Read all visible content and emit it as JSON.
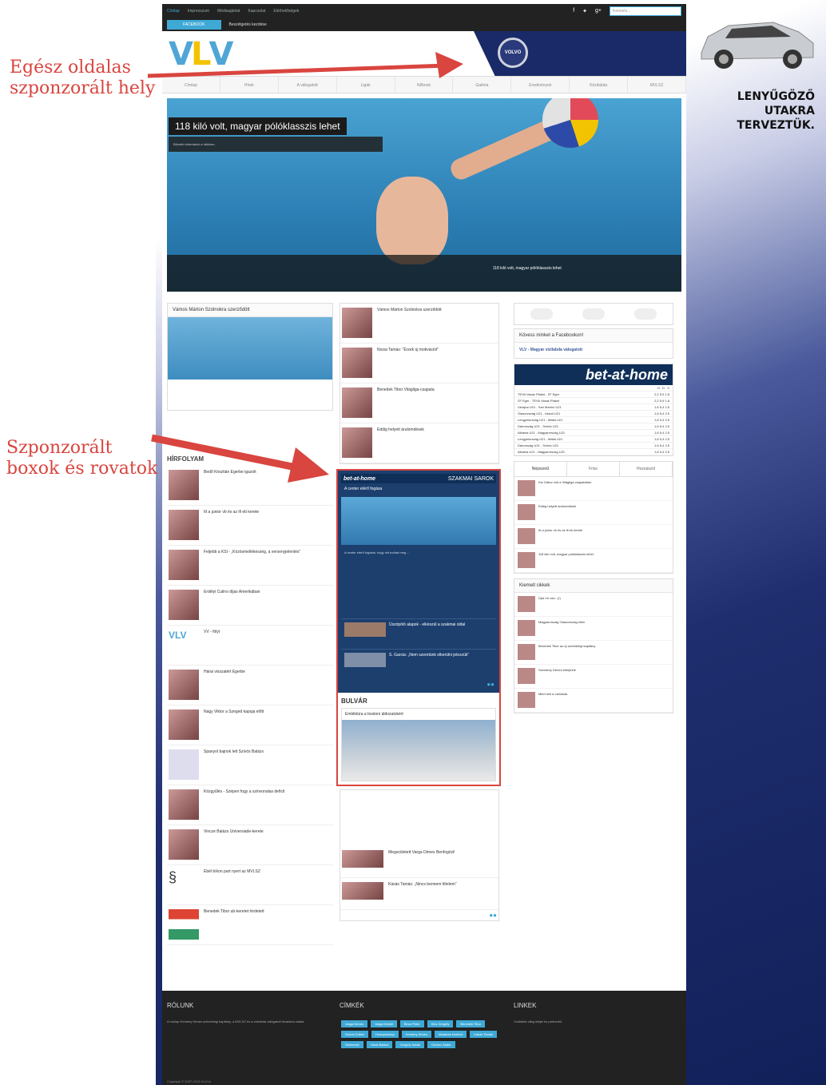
{
  "annotations": {
    "fullpage": [
      "Egész oldalas",
      "szponzorált hely"
    ],
    "boxes": [
      "Szponzorált",
      "boxok és rovatok"
    ]
  },
  "topbar": {
    "nav": [
      "Címlap",
      "Impresszum",
      "Médiaajánlat",
      "Kapcsolat",
      "Elérhetőségek"
    ],
    "search_placeholder": "Keresés..."
  },
  "subbar": {
    "facebook": "FACEBOOK",
    "ticker": "Beszélgetés kezdése"
  },
  "logo": {
    "v1": "V",
    "l": "L",
    "v2": "V"
  },
  "brand": {
    "badge": "VOLVO"
  },
  "menu": [
    "Címlap",
    "Hírek",
    "A válogatott",
    "Ligák",
    "Nőknek",
    "Galéria",
    "Eredmények",
    "Kézilabda",
    "MVLSZ"
  ],
  "hero": {
    "title": "118 kiló volt, magyar pólóklasszis lehet",
    "lead": "Bővebb információ a cikkben...",
    "strip": [
      "",
      "",
      "",
      "118 kiló volt, magyar pólóklasszis lehet",
      ""
    ]
  },
  "col1": {
    "feature_title": "Vámos Márton Szolnokra szerződött",
    "news_header": "HÍRFOLYAM",
    "items": [
      "Bedő Krisztián Egerbe igazolt",
      "Itt a junior vb és az ifi eb kerete",
      "Feljebb a KSI - „Közösmellékesség, a versenyjelentés”",
      "Erdélyi Culino díjas Amerikában",
      "VV - fölyt",
      "Hárai visszatért Egerbe",
      "Nagy Viktor a Szeged kapuja előtt",
      "Spanyol bajnok lett Szívós Balázs",
      "Közgyűlés - Szépen fogy a szinvonalas deficit",
      "Vincze Balázs Universiade-kerete",
      "Ebél bíkon part nyert az MVLSZ",
      "Benedek Tibor ub-keretet hirdetett"
    ]
  },
  "col2": {
    "items": [
      "Vámos Márton Szolnokra szerződött",
      "Nozai Tamás: \"Érzek új motivációt\"",
      "Benedek Tibor Világliga-csapata",
      "Eddig helyett árulomdések"
    ],
    "sponsor": {
      "brand": "bet-at-home",
      "section": "SZAKMAI SAROK",
      "headline": "A center elérő fogása",
      "body": "A center elérő fogásai, hogy mit tudhat meg....",
      "list": [
        "Úszópóló alapok - elkészül a szakmai oldal",
        "S. Garcia: „Nem szeretünk elkerülni jelezzük”"
      ]
    },
    "bulvar": {
      "header": "BULVÁR",
      "title": "Emléktúra a bostoni áldozatokért"
    },
    "after": [
      "Megszületett Varga Dénes Benfogózi!",
      "Kásás Tamás: „Nincs bennem félelem”"
    ]
  },
  "col3": {
    "facebook": "Kövess minket a Facebookon!",
    "fb_page": "VLV - Magyar vízilabda válogatott",
    "betathome": "bet-at-home",
    "odds_header": [
      "H",
      "D",
      "V"
    ],
    "matches": [
      [
        "TEVA Vasas Plaket - ZF Eger",
        "2,2",
        "5,9",
        "1,8"
      ],
      [
        "ZF Eger - TEVA Vasas Plaket",
        "2,2",
        "5,9",
        "1,8"
      ],
      [
        "Ukrajna U21 - San Marino U21",
        "1,6",
        "5,4",
        "2,5"
      ],
      [
        "Olaszország U21 - Izland U21",
        "1,6",
        "5,4",
        "2,5"
      ],
      [
        "Lengyelország U21 - Málta U21",
        "1,6",
        "5,4",
        "2,5"
      ],
      [
        "Dánország U21 - Svédo U21",
        "1,6",
        "5,4",
        "2,5"
      ],
      [
        "Albánia U21 - Magyarország U21",
        "1,6",
        "5,4",
        "2,5"
      ],
      [
        "Lengyelország U21 - Málta U21",
        "1,6",
        "5,4",
        "2,5"
      ],
      [
        "Dánország U21 - Svédo U21",
        "1,6",
        "5,4",
        "2,5"
      ],
      [
        "Albánia U21 - Magyarország U21",
        "1,6",
        "5,4",
        "2,5"
      ]
    ],
    "tabs": [
      "Népszerű",
      "Friss",
      "Hozzászól"
    ],
    "popular": [
      "Kis Gábor volt a Világliga csapatában",
      "Eddig helyett árulomdések",
      "Itt a junior vb és az ifi eb kerete",
      "118 kiló volt, magyar pólóklasszis lehet"
    ],
    "featured_header": "Kiemelt cikkek",
    "featured": [
      "Újra hír van...(!)",
      "Magyarország Olaszország ellen",
      "Benedek Tibor az új szövetségi kapitány",
      "Szendrey Dénes befejezte",
      "Miért kell a vízilabda"
    ]
  },
  "footer": {
    "about_h": "RÓLUNK",
    "about": "A honlap Kemény Dénes szövetségi kapitány, a MVLSZ és a vízilabda válogatott hivatalos oldala.",
    "tags_h": "CÍMKÉK",
    "tags": [
      "Varga Dénes",
      "Varga Dániel",
      "Biros Péter",
      "Kiss Gergely",
      "Benedek Tibor",
      "Szécsi Zoltán",
      "Hosnyánszky",
      "Kemény Dénes",
      "Madaras Norbert",
      "Kásás Tamás",
      "Steinmetz",
      "Hárai Balázs",
      "Gergely István",
      "Decker Ádám"
    ],
    "links_h": "LINKEK",
    "links": "Vízilabda világ linkjei és partnerek.",
    "copyright": "Copyright © 2007-2013 VLV.hu"
  },
  "ad": {
    "slogan": [
      "LENYŰGÖZŐ UTAKRA",
      "TERVEZTÜK."
    ]
  }
}
